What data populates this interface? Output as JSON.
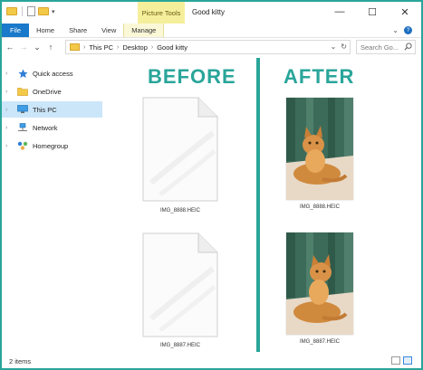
{
  "window": {
    "context_tab": "Picture Tools",
    "title": "Good kitty",
    "controls": {
      "minimize": "—",
      "maximize": "☐",
      "close": "✕"
    }
  },
  "ribbon": {
    "tabs": [
      "File",
      "Home",
      "Share",
      "View",
      "Manage"
    ],
    "collapse": "⌄"
  },
  "address": {
    "back": "←",
    "forward": "→",
    "recent": "⌄",
    "up": "↑",
    "crumbs": [
      "This PC",
      "Desktop",
      "Good kitty"
    ],
    "separator": "›",
    "search_placeholder": "Search Go..."
  },
  "sidebar": {
    "items": [
      {
        "label": "Quick access",
        "icon": "star-icon"
      },
      {
        "label": "OneDrive",
        "icon": "folder-icon"
      },
      {
        "label": "This PC",
        "icon": "computer-icon",
        "selected": true
      },
      {
        "label": "Network",
        "icon": "network-icon"
      },
      {
        "label": "Homegroup",
        "icon": "homegroup-icon"
      }
    ]
  },
  "content": {
    "before_heading": "BEFORE",
    "after_heading": "AFTER",
    "before_files": [
      "IMG_8888.HEIC",
      "IMG_8887.HEIC"
    ],
    "after_files": [
      "IMG_8888.HEIC",
      "IMG_8887.HEIC"
    ]
  },
  "status": {
    "item_count": "2 items"
  },
  "colors": {
    "accent": "#2aa59a",
    "file_tab": "#1979ca",
    "selection": "#cce6f9",
    "picture_tools": "#f5ef9c"
  }
}
